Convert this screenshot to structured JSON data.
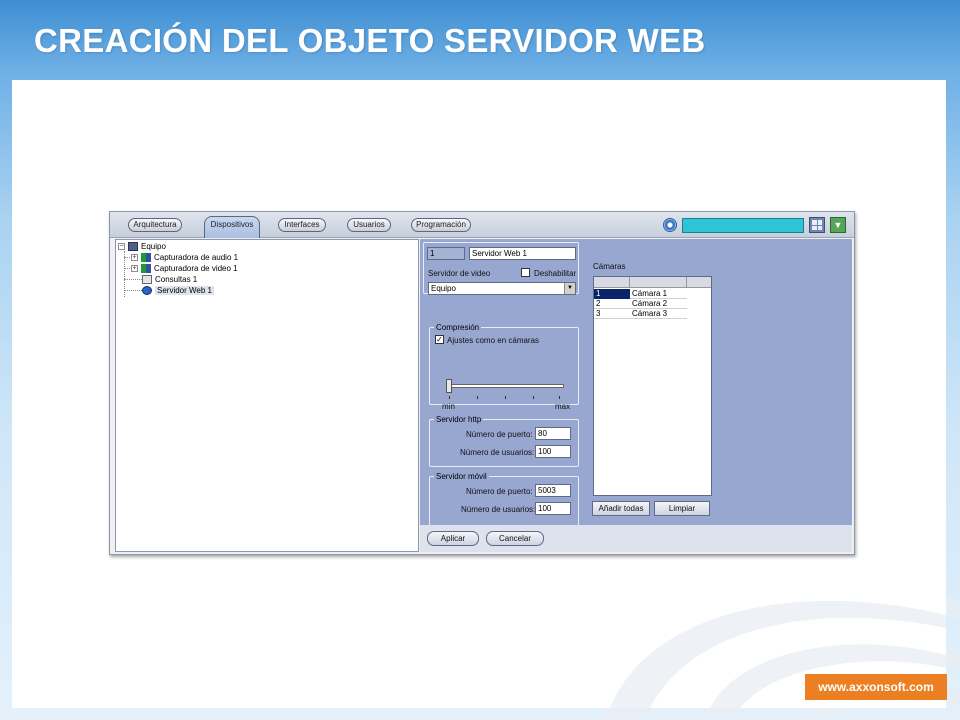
{
  "slide": {
    "title": "CREACIÓN DEL OBJETO SERVIDOR WEB",
    "url": "www.axxonsoft.com"
  },
  "app": {
    "tabs": [
      {
        "label": "Arquitectura",
        "active": false
      },
      {
        "label": "Dispositivos",
        "active": true
      },
      {
        "label": "Interfaces",
        "active": false
      },
      {
        "label": "Usuarios",
        "active": false
      },
      {
        "label": "Programación",
        "active": false
      }
    ],
    "tree": {
      "root": "Equipo",
      "items": [
        {
          "label": "Capturadora de audio 1",
          "icon": "audio-capture-icon"
        },
        {
          "label": "Capturadora de video 1",
          "icon": "video-capture-icon"
        },
        {
          "label": "Consultas 1",
          "icon": "query-icon"
        },
        {
          "label": "Servidor Web 1",
          "icon": "web-server-icon",
          "selected": true
        }
      ]
    },
    "object": {
      "id": "1",
      "name": "Servidor Web 1",
      "video_server_label": "Servidor de video",
      "disable_label": "Deshabilitar",
      "disable_checked": false,
      "video_server_value": "Equipo"
    },
    "compression": {
      "legend": "Compresión",
      "checkbox_label": "Ajustes como en cámaras",
      "checked": true,
      "slider_level": 0,
      "min_label": "min",
      "max_label": "max"
    },
    "http_server": {
      "legend": "Servidor http",
      "port_label": "Número de puerto:",
      "port_value": "80",
      "users_label": "Número de usuarios:",
      "users_value": "100"
    },
    "mobile_server": {
      "legend": "Servidor móvil",
      "port_label": "Número de puerto:",
      "port_value": "5003",
      "users_label": "Número de usuarios:",
      "users_value": "100"
    },
    "cameras": {
      "label": "Cámaras",
      "rows": [
        {
          "num": "1",
          "name": "Cámara 1",
          "selected": true
        },
        {
          "num": "2",
          "name": "Cámara 2",
          "selected": false
        },
        {
          "num": "3",
          "name": "Cámara 3",
          "selected": false
        }
      ],
      "add_all_label": "Añadir todas",
      "clear_label": "Limpiar"
    },
    "buttons": {
      "apply": "Aplicar",
      "cancel": "Cancelar"
    },
    "colors": {
      "settings_bg": "#98a7d0",
      "accent_orange": "#ec7f21",
      "search_bar": "#2ec3d6"
    }
  }
}
